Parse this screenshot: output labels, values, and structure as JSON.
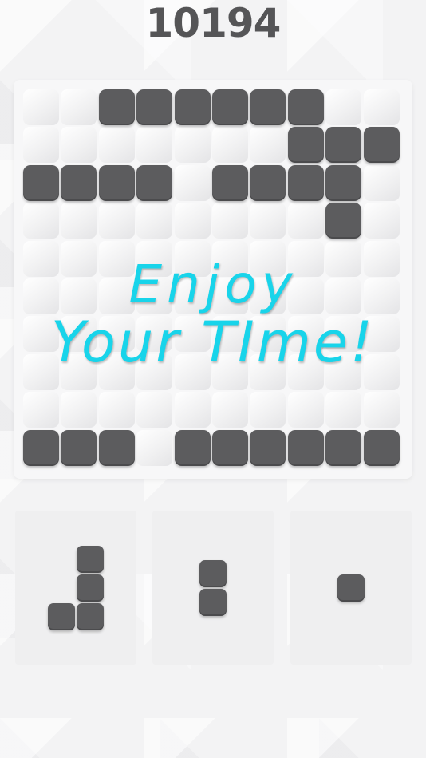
{
  "game": {
    "score": "10194",
    "overlay_line1": "Enjoy",
    "overlay_line2": "Your TIme!"
  },
  "board": {
    "columns": 10,
    "rows": 10,
    "filled_cells": [
      [
        0,
        2
      ],
      [
        0,
        3
      ],
      [
        0,
        4
      ],
      [
        0,
        5
      ],
      [
        0,
        6
      ],
      [
        0,
        7
      ],
      [
        1,
        7
      ],
      [
        1,
        8
      ],
      [
        1,
        9
      ],
      [
        2,
        0
      ],
      [
        2,
        1
      ],
      [
        2,
        2
      ],
      [
        2,
        3
      ],
      [
        2,
        5
      ],
      [
        2,
        6
      ],
      [
        2,
        7
      ],
      [
        2,
        8
      ],
      [
        3,
        8
      ],
      [
        9,
        0
      ],
      [
        9,
        1
      ],
      [
        9,
        2
      ],
      [
        9,
        4
      ],
      [
        9,
        5
      ],
      [
        9,
        6
      ],
      [
        9,
        7
      ],
      [
        9,
        8
      ],
      [
        9,
        9
      ]
    ]
  },
  "trays": [
    {
      "name": "j-piece",
      "cells": [
        [
          0,
          1
        ],
        [
          1,
          1
        ],
        [
          2,
          0
        ],
        [
          2,
          1
        ]
      ]
    },
    {
      "name": "vertical-domino",
      "cells": [
        [
          0,
          0
        ],
        [
          1,
          0
        ]
      ]
    },
    {
      "name": "single-block",
      "cells": [
        [
          0,
          0
        ]
      ]
    }
  ],
  "colors": {
    "block": "#5c5c5e",
    "overlay_text": "#18d4ea",
    "score_text": "#555557"
  }
}
